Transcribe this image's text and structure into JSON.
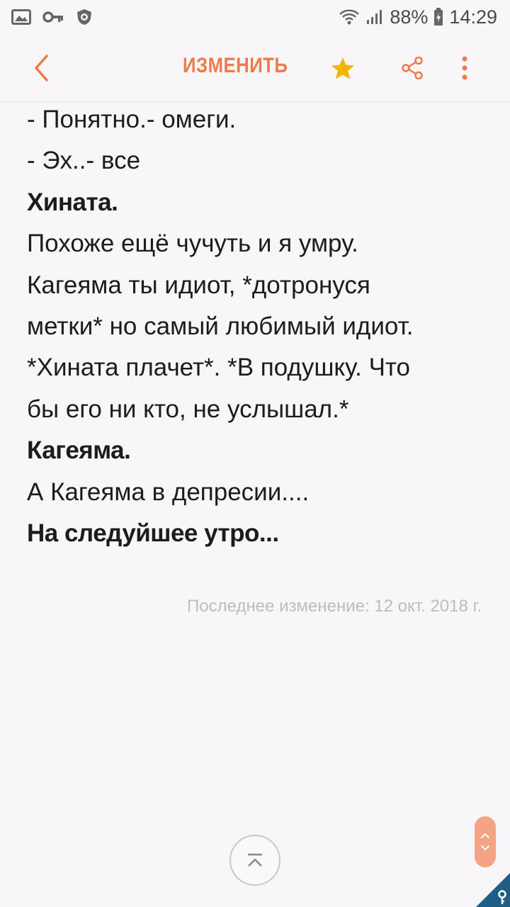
{
  "status_bar": {
    "icons_left": [
      "gallery-icon",
      "key-icon",
      "shield-icon"
    ],
    "battery": "88%",
    "time": "14:29"
  },
  "toolbar": {
    "edit_label": "ИЗМЕНИТЬ",
    "accent_color": "#ef7b4d",
    "star_color": "#f5b400"
  },
  "note": {
    "lines": [
      "- Понятно.- омеги.",
      "- Эх..- все",
      "Хината.",
      "Похоже ещё чучуть и я умру.",
      "Кагеяма ты идиот, *дотронуся",
      "метки* но самый любимый идиот.",
      "*Хината плачет*. *В подушку. Что",
      "бы его ни кто, не услышал.*",
      "Кагеяма.",
      "А Кагеяма в депресии....",
      "На следуйшее утро..."
    ],
    "last_modified": "Последнее изменение: 12 окт. 2018 г."
  }
}
